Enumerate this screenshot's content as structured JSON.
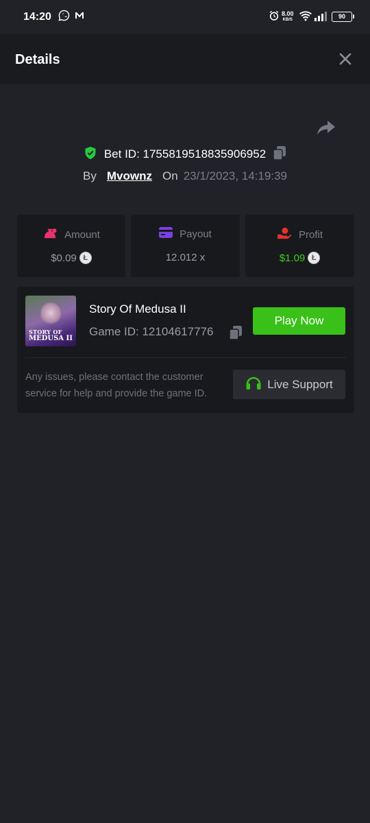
{
  "status_bar": {
    "time": "14:20",
    "net_speed_value": "8.00",
    "net_speed_unit": "KB/S",
    "battery": "90"
  },
  "header": {
    "title": "Details"
  },
  "bet": {
    "id_label": "Bet ID: 1755819518835906952",
    "by_label": "By",
    "username": "Mvownz",
    "on_label": "On",
    "datetime": "23/1/2023, 14:19:39"
  },
  "stats": {
    "amount": {
      "label": "Amount",
      "value": "$0.09",
      "icon": "money-bag-icon",
      "color": "#e8336d"
    },
    "payout": {
      "label": "Payout",
      "value": "12.012 x",
      "icon": "card-icon",
      "color": "#7b3fe4"
    },
    "profit": {
      "label": "Profit",
      "value": "$1.09",
      "icon": "hand-coin-icon",
      "color": "#e0332f",
      "value_color": "#3ccc1c"
    }
  },
  "coin_symbol": "Ł",
  "game": {
    "thumb_line1": "STORY OF",
    "thumb_line2": "MEDUSA II",
    "name": "Story Of Medusa II",
    "id_label": "Game ID: 12104617776",
    "play_label": "Play Now",
    "issue_text": "Any issues, please contact the customer service for help and provide the game ID.",
    "support_label": "Live Support"
  },
  "colors": {
    "background": "#212227",
    "card": "#18191d",
    "accent_green": "#39c119",
    "shield_green": "#27c93f"
  }
}
